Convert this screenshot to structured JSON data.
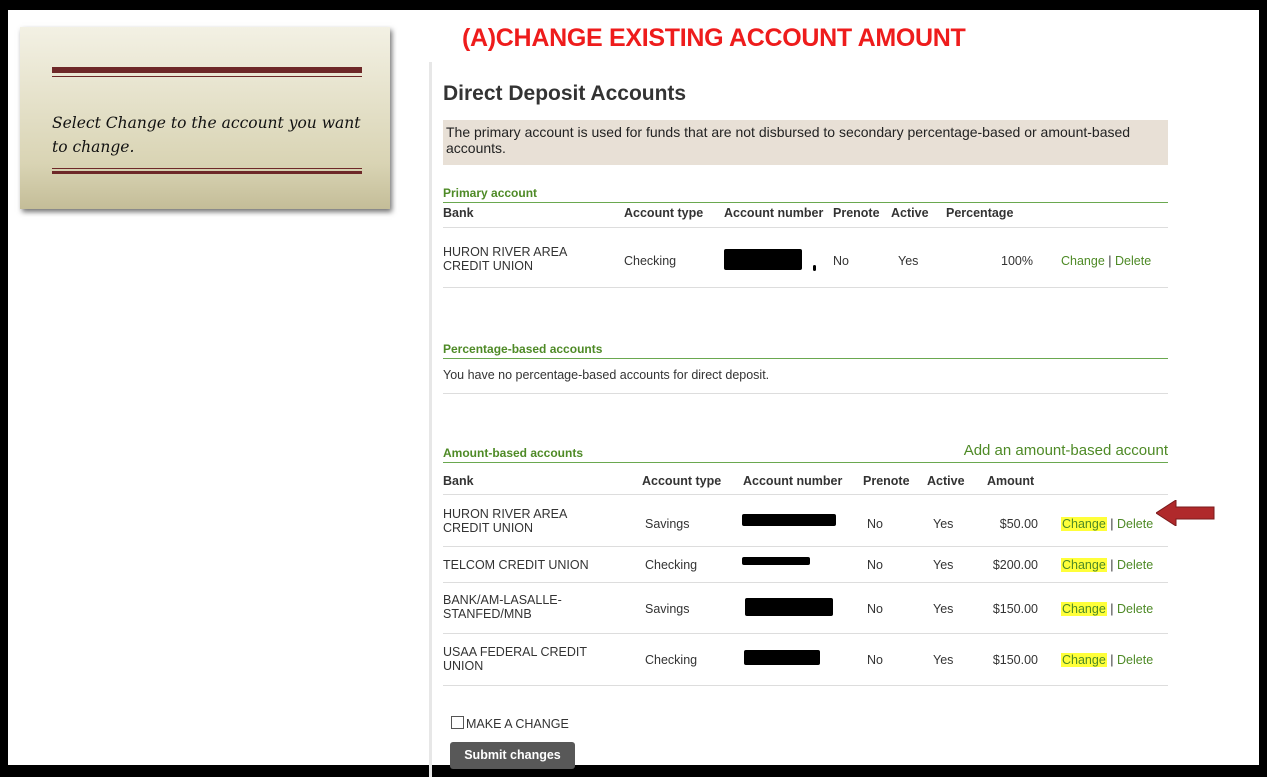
{
  "banner": "(A)CHANGE EXISTING ACCOUNT AMOUNT",
  "callout": {
    "text": "Select Change to the account you want to change."
  },
  "page": {
    "title": "Direct Deposit Accounts",
    "info": "The primary account is used for funds that are not disbursed to secondary percentage-based or amount-based accounts."
  },
  "primary": {
    "heading": "Primary account",
    "headers": {
      "bank": "Bank",
      "type": "Account type",
      "number": "Account number",
      "prenote": "Prenote",
      "active": "Active",
      "value": "Percentage"
    },
    "rows": [
      {
        "bank": "HURON RIVER AREA CREDIT UNION",
        "type": "Checking",
        "prenote": "No",
        "active": "Yes",
        "value": "100%",
        "change": "Change",
        "sep": "|",
        "delete": "Delete"
      }
    ]
  },
  "percentage": {
    "heading": "Percentage-based accounts",
    "empty": "You have no percentage-based accounts for direct deposit."
  },
  "amount": {
    "heading": "Amount-based accounts",
    "add_link": "Add an amount-based account",
    "headers": {
      "bank": "Bank",
      "type": "Account type",
      "number": "Account number",
      "prenote": "Prenote",
      "active": "Active",
      "value": "Amount"
    },
    "rows": [
      {
        "bank": "HURON RIVER AREA CREDIT UNION",
        "type": "Savings",
        "prenote": "No",
        "active": "Yes",
        "value": "$50.00",
        "change": "Change",
        "sep": "|",
        "delete": "Delete"
      },
      {
        "bank": "TELCOM CREDIT UNION",
        "type": "Checking",
        "prenote": "No",
        "active": "Yes",
        "value": "$200.00",
        "change": "Change",
        "sep": "|",
        "delete": "Delete"
      },
      {
        "bank": "BANK/AM-LASALLE-STANFED/MNB",
        "type": "Savings",
        "prenote": "No",
        "active": "Yes",
        "value": "$150.00",
        "change": "Change",
        "sep": "|",
        "delete": "Delete"
      },
      {
        "bank": "USAA FEDERAL CREDIT UNION",
        "type": "Checking",
        "prenote": "No",
        "active": "Yes",
        "value": "$150.00",
        "change": "Change",
        "sep": "|",
        "delete": "Delete"
      }
    ]
  },
  "footer": {
    "checkbox_label": "MAKE A CHANGE",
    "submit": "Submit changes"
  },
  "colors": {
    "banner": "#ee1c1c",
    "link": "#4e8a26",
    "highlight": "#ffff3a",
    "arrow": "#b0292b"
  }
}
